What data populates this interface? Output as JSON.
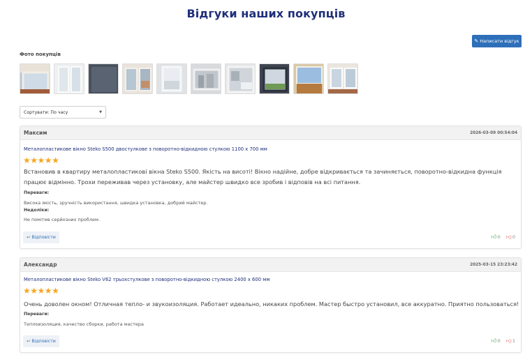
{
  "page": {
    "title": "Відгуки наших покупців"
  },
  "toolbar": {
    "write_label": "Написати відгук"
  },
  "photos": {
    "label": "Фото покупців",
    "thumbs": [
      {
        "name": "photo-1"
      },
      {
        "name": "photo-2"
      },
      {
        "name": "photo-3"
      },
      {
        "name": "photo-4"
      },
      {
        "name": "photo-5"
      },
      {
        "name": "photo-6"
      },
      {
        "name": "photo-7"
      },
      {
        "name": "photo-8"
      },
      {
        "name": "photo-9"
      },
      {
        "name": "photo-10"
      }
    ]
  },
  "sort": {
    "selected": "Сортувати: По часу"
  },
  "reviews": [
    {
      "author": "Максим",
      "date": "2026-03-09 00:54:04",
      "product": "Металопластикове вікно Steko S500 двостулкове з поворотно-відкидною стулкою 1100 x 700 мм",
      "rating": 5,
      "text": "Встановив в квартиру металопластикові вікна Steko S500. Якість на висоті! Вікно надійне, добре відкривається та зачиняється, поворотно-відкидна функція працює відмінно. Трохи переживав через установку, але майстер швидко все зробив і відповів на всі питання.",
      "pros_label": "Переваги:",
      "pros": "Висока якість, зручність використання, швидка установка, добрий майстер.",
      "cons_label": "Недоліки:",
      "cons": "Не помітив серйозних проблем.",
      "reply_label": "Відповісти",
      "likes": "0",
      "dislikes": "0"
    },
    {
      "author": "Александр",
      "date": "2025-03-15 23:23:42",
      "product": "Металопластикове вікно Steko V62 трьохстулкове з поворотно-відкидною стулкою 2400 x 600 мм",
      "rating": 5,
      "text": "Очень доволен окном! Отличная тепло- и звукоизоляция. Работает идеально, никаких проблем. Мастер быстро установил, все аккуратно. Приятно пользоваться!",
      "pros_label": "Переваги:",
      "pros": "Теплоизоляция, качество сборки, работа мастера",
      "reply_label": "Відповісти",
      "likes": "0",
      "dislikes": "1"
    }
  ],
  "icons": {
    "write": "pencil-icon",
    "reply": "reply-icon",
    "like": "thumbs-up-icon",
    "dislike": "thumbs-down-icon",
    "sort": "chevron-down-icon"
  },
  "colors": {
    "title": "#1f2f7a",
    "button": "#2e6fba",
    "star": "#f5a623",
    "like": "#2ea84a",
    "dislike": "#e06060"
  }
}
